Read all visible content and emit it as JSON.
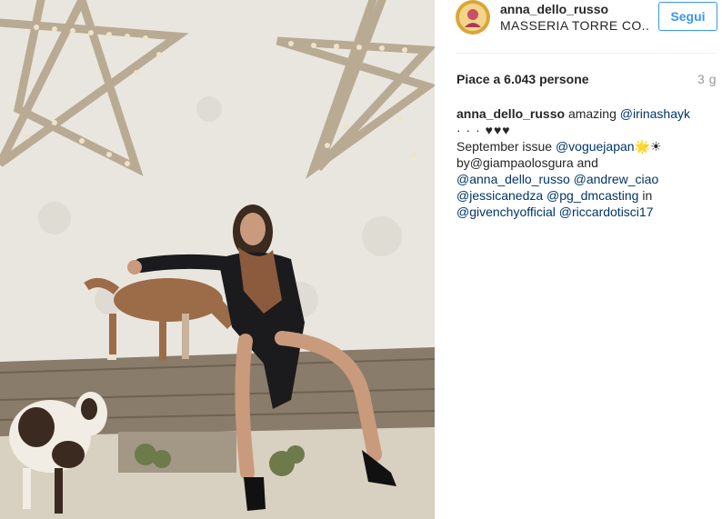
{
  "header": {
    "username": "anna_dello_russo",
    "location": "MASSERIA TORRE CO..",
    "follow_label": "Segui"
  },
  "stats": {
    "likes_text": "Piace a 6.043 persone",
    "time_ago": "3 g"
  },
  "caption": {
    "author": "anna_dello_russo",
    "line1": {
      "text": "amazing",
      "mention": "@irinashayk"
    },
    "line2": {
      "text": "· · · ♥♥♥"
    },
    "line3": {
      "text": "September issue",
      "mention": "@voguejapan",
      "suffix": "🌟☀"
    },
    "line4": {
      "text": "by@giampaolosgura and"
    },
    "line5": {
      "mention1": "@anna_dello_russo",
      "mention2": "@andrew_ciao"
    },
    "line6": {
      "mention1": "@jessicanedza",
      "mention2": "@pg_dmcasting",
      "text": "in"
    },
    "line7": {
      "mention1": "@givenchyofficial",
      "mention2": "@riccardotisci17"
    }
  },
  "icons": {
    "avatar": "profile-avatar",
    "post_image": "photo-model-with-goats"
  },
  "colors": {
    "accent": "#3897f0",
    "link": "#003569",
    "text": "#262626",
    "muted": "#999999"
  }
}
